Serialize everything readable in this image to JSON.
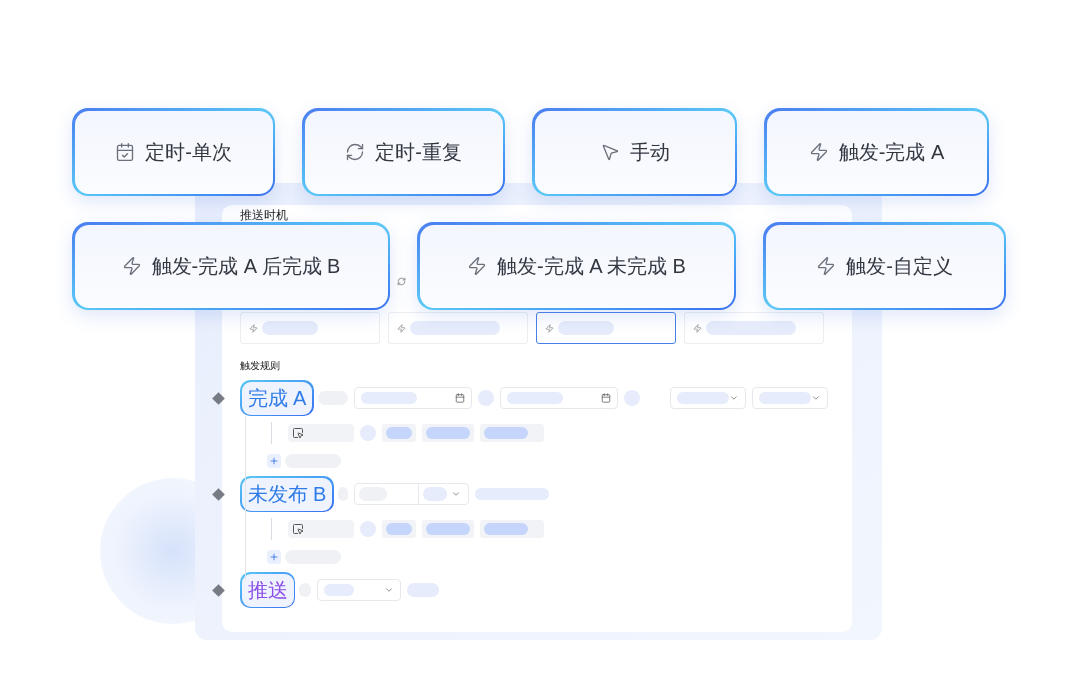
{
  "option_cards": [
    [
      {
        "label": "定时-单次",
        "kind": "once"
      },
      {
        "label": "定时-重复",
        "kind": "repeat"
      },
      {
        "label": "手动",
        "kind": "manual"
      },
      {
        "label": "触发-完成 A",
        "kind": "trigger"
      }
    ],
    [
      {
        "label": "触发-完成 A 后完成 B",
        "kind": "trigger"
      },
      {
        "label": "触发-完成 A 未完成 B",
        "kind": "trigger"
      },
      {
        "label": "触发-自定义",
        "kind": "trigger"
      }
    ]
  ],
  "panel": {
    "title": "推送时机",
    "option_slots": [
      {
        "selected": false
      },
      {
        "selected": false
      },
      {
        "selected": true
      },
      {
        "selected": false
      }
    ],
    "rules_title": "触发规则",
    "rules": [
      {
        "label": "完成 A",
        "kind": "date_window",
        "color": "#2f7be8"
      },
      {
        "label": "未发布 B",
        "kind": "status_select",
        "color": "#2f7be8"
      },
      {
        "label": "推送",
        "kind": "push_select",
        "color": "#8b4ee8"
      }
    ]
  }
}
